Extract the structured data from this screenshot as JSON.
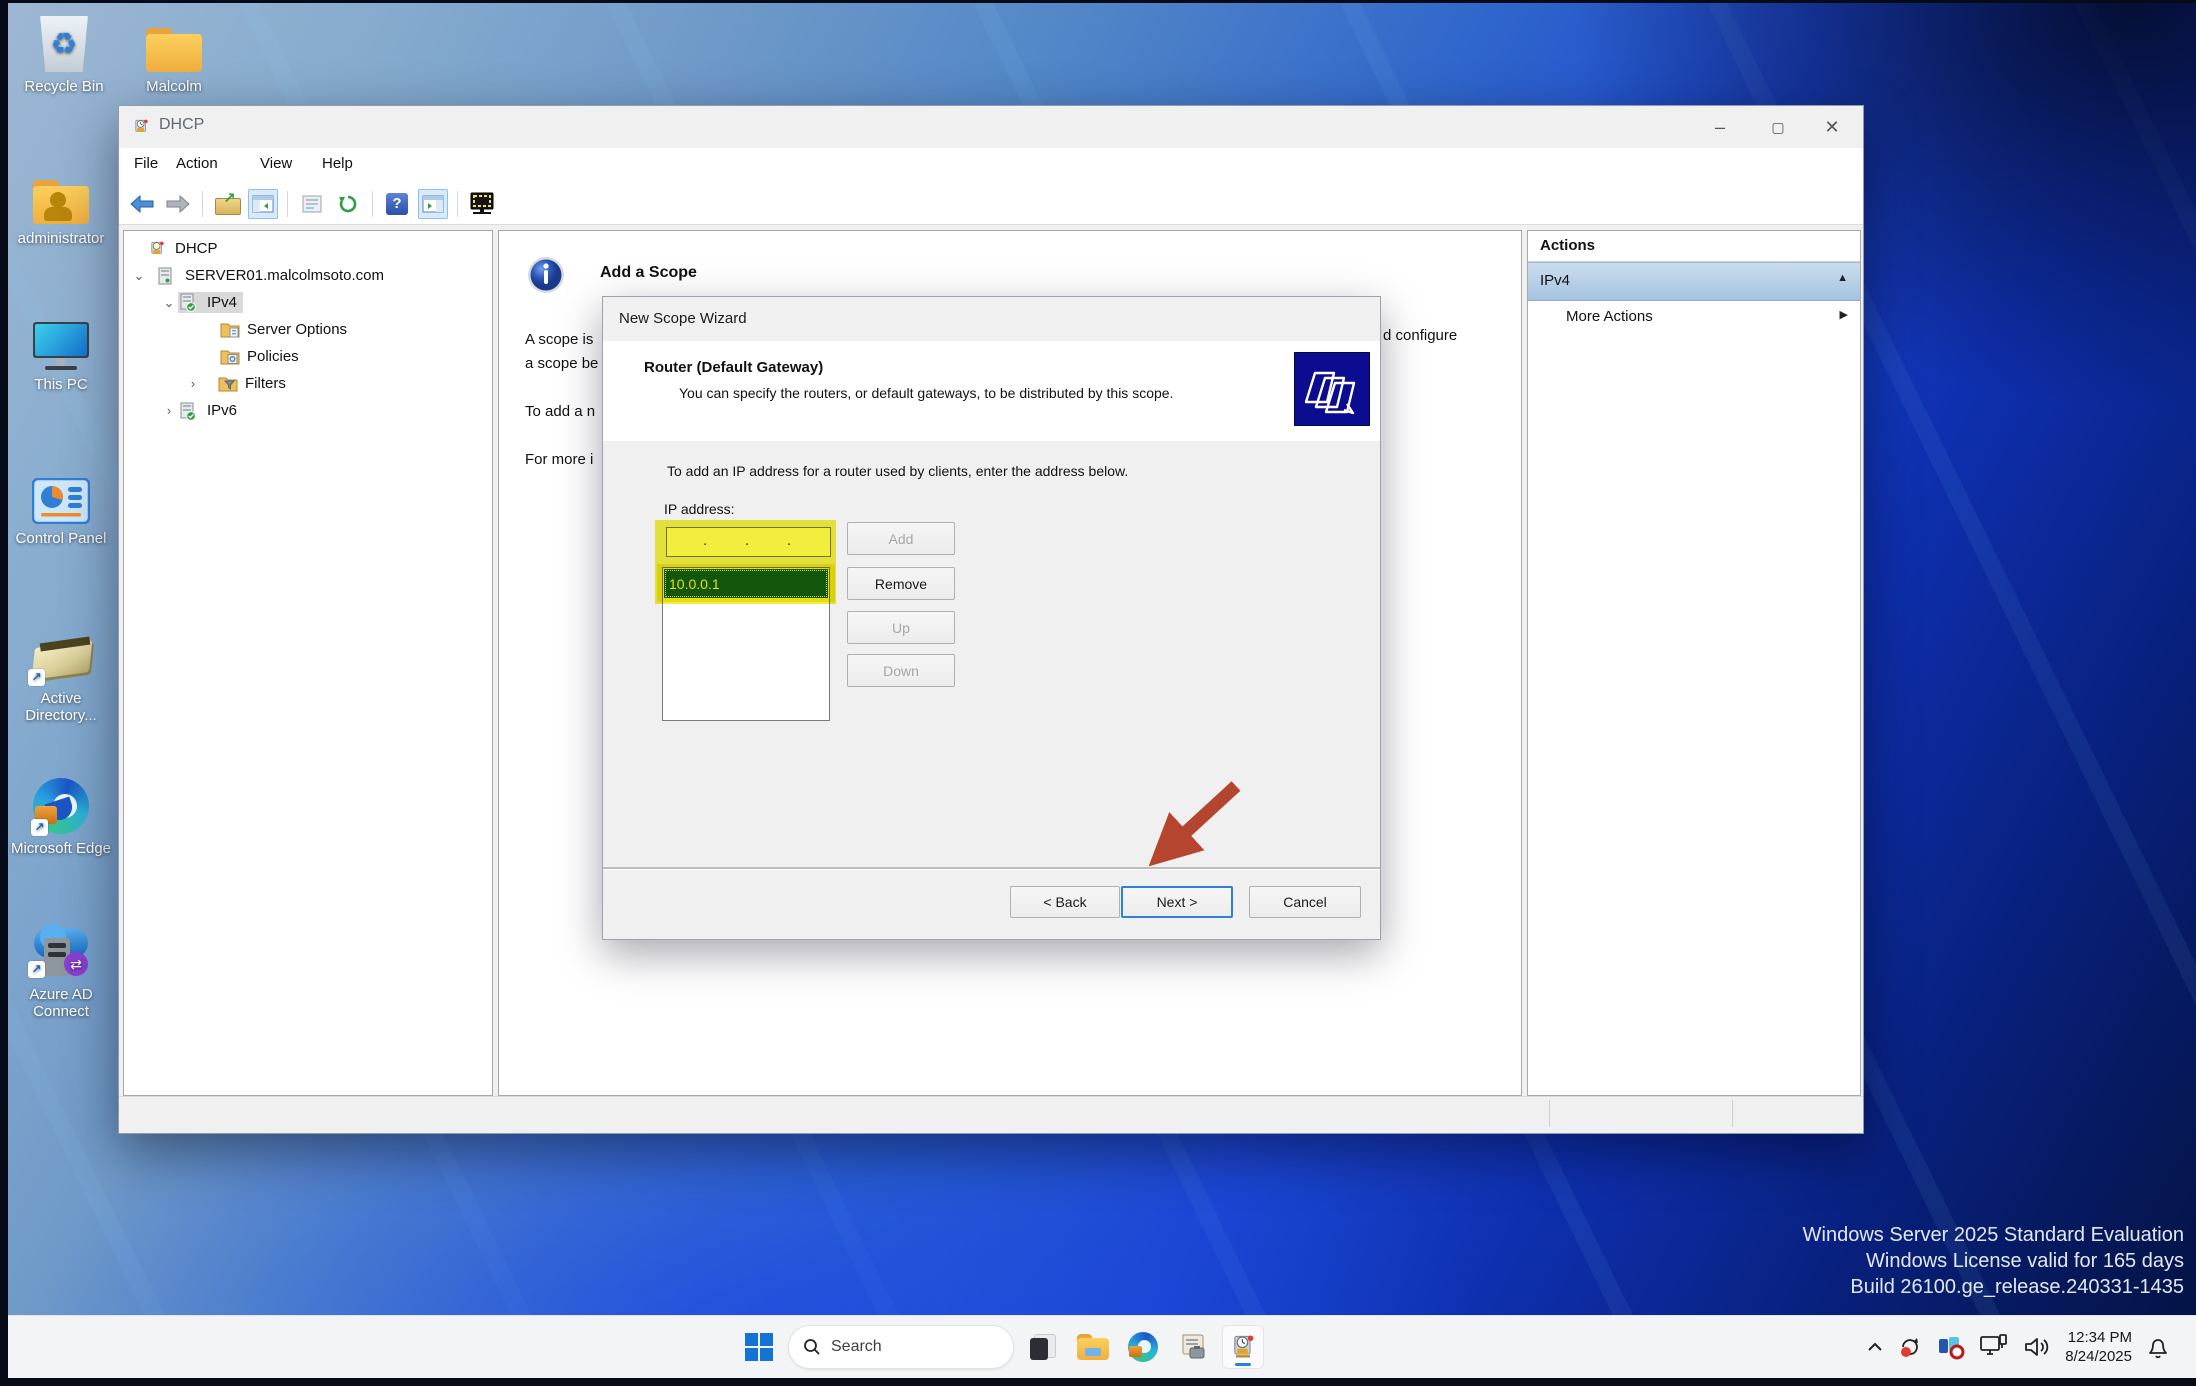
{
  "desktop": {
    "icons": [
      {
        "label": "Recycle Bin"
      },
      {
        "label": "Malcolm"
      },
      {
        "label": "administrator"
      },
      {
        "label": "This PC"
      },
      {
        "label": "Control Panel"
      },
      {
        "label": "Active Directory..."
      },
      {
        "label": "Microsoft Edge"
      },
      {
        "label": "Azure AD Connect"
      }
    ]
  },
  "watermark": {
    "line1": "Windows Server 2025 Standard Evaluation",
    "line2": "Windows License valid for 165 days",
    "line3": "Build 26100.ge_release.240331-1435"
  },
  "window": {
    "title": "DHCP",
    "menu": [
      "File",
      "Action",
      "View",
      "Help"
    ],
    "controls": {
      "minimize": "–",
      "maximize": "▢",
      "close": "✕"
    }
  },
  "tree": {
    "items": [
      {
        "label": "DHCP"
      },
      {
        "label": "SERVER01.malcolmsoto.com"
      },
      {
        "label": "IPv4"
      },
      {
        "label": "Server Options"
      },
      {
        "label": "Policies"
      },
      {
        "label": "Filters"
      },
      {
        "label": "IPv6"
      }
    ],
    "chevron_open": "⌄",
    "chevron_closed": "›"
  },
  "content": {
    "heading": "Add a Scope",
    "fragments": {
      "f1": "A scope is",
      "f2": "a scope be",
      "f3": "To add a n",
      "f4": "For more i",
      "f5": "d configure"
    }
  },
  "actions_pane": {
    "title": "Actions",
    "group": "IPv4",
    "group_collapse_glyph": "▲",
    "more": "More Actions",
    "more_glyph": "▶"
  },
  "wizard": {
    "title": "New Scope Wizard",
    "page_title": "Router (Default Gateway)",
    "page_subtitle": "You can specify the routers, or default gateways, to be distributed by this scope.",
    "instruction": "To add an IP address for a router used by clients, enter the address below.",
    "ip_label": "IP address:",
    "dots": [
      ".",
      ".",
      "."
    ],
    "list": [
      {
        "value": "10.0.0.1"
      }
    ],
    "buttons": {
      "add": "Add",
      "remove": "Remove",
      "up": "Up",
      "down": "Down",
      "back": "< Back",
      "next": "Next >",
      "cancel": "Cancel"
    }
  },
  "taskbar": {
    "search_placeholder": "Search"
  },
  "tray": {
    "time": "12:34 PM",
    "date": "8/24/2025"
  },
  "colors": {
    "accent_blue": "#2f7fd6",
    "highlight_yellow": "#f2ee3e",
    "annotation_arrow_red": "#b5452f",
    "effective_selection_green": "#15603a",
    "wallpaper_light": "#9db7d3",
    "wallpaper_dark": "#041240"
  }
}
